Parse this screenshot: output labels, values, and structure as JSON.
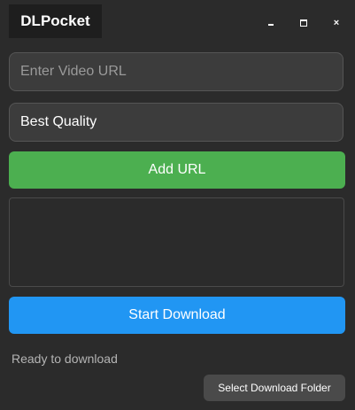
{
  "app": {
    "title": "DLPocket"
  },
  "window_controls": {
    "minimize_icon": "minimize-icon",
    "maximize_icon": "maximize-icon",
    "close_icon": "close-icon",
    "close_glyph": "×"
  },
  "url_input": {
    "value": "",
    "placeholder": "Enter Video URL"
  },
  "quality_select": {
    "selected": "Best Quality"
  },
  "buttons": {
    "add_url": "Add URL",
    "start_download": "Start Download",
    "select_folder": "Select Download Folder"
  },
  "url_list": {
    "items": []
  },
  "status": {
    "text": "Ready to download"
  },
  "colors": {
    "background": "#2b2b2b",
    "add_button": "#4caf50",
    "start_button": "#2196f3",
    "field_background": "#3c3c3c"
  }
}
